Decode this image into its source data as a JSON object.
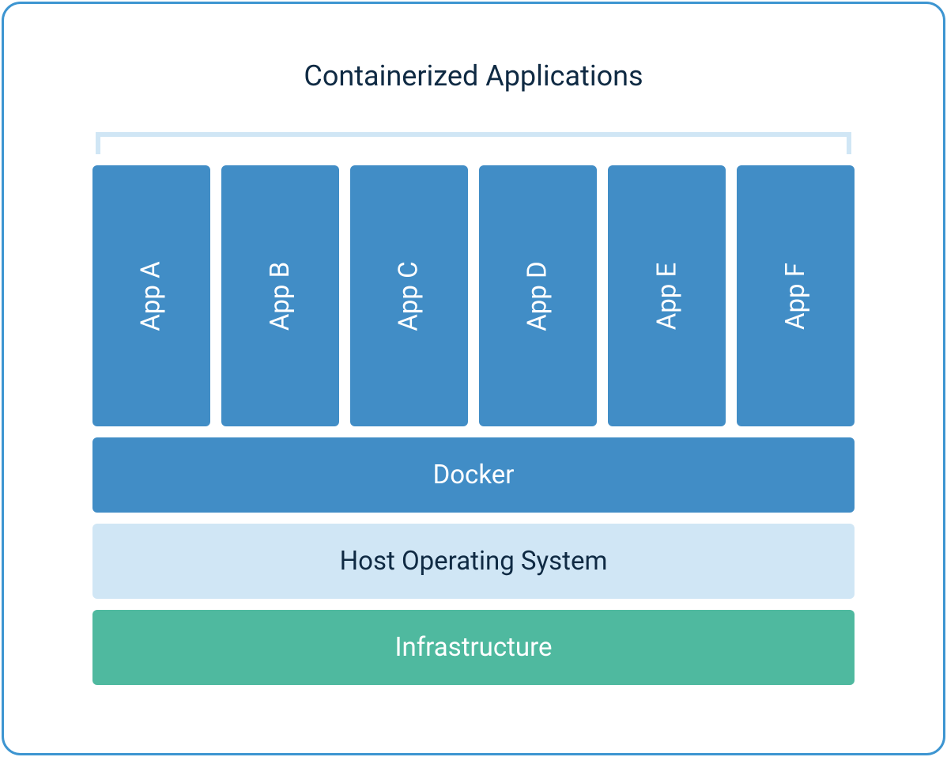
{
  "title": "Containerized Applications",
  "apps": [
    {
      "label": "App A"
    },
    {
      "label": "App B"
    },
    {
      "label": "App C"
    },
    {
      "label": "App D"
    },
    {
      "label": "App E"
    },
    {
      "label": "App F"
    }
  ],
  "layers": {
    "docker": "Docker",
    "host": "Host Operating System",
    "infrastructure": "Infrastructure"
  },
  "colors": {
    "frame_border": "#3d95d1",
    "app_box": "#418dc6",
    "bracket": "#d0e6f5",
    "host_bg": "#d0e6f5",
    "infra_bg": "#4fb99f",
    "title_text": "#0f2a43"
  }
}
